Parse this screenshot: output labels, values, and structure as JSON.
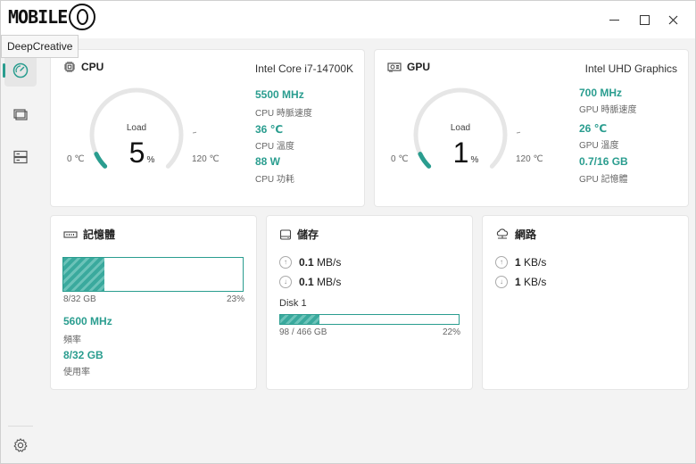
{
  "app": {
    "logo_text": "MOBILE",
    "tooltip": "DeepCreative"
  },
  "window_controls": {
    "minimize": "minimize",
    "maximize": "maximize",
    "close": "close"
  },
  "sidebar": {
    "items": [
      "dashboard-gauge-icon",
      "monitor-icon",
      "storage-icon"
    ],
    "settings": "gear-icon"
  },
  "cpu": {
    "title": "CPU",
    "model": "Intel Core i7-14700K",
    "load_label": "Load",
    "load_value": "5",
    "load_unit": "%",
    "min_label": "0 ℃",
    "max_label": "120 ℃",
    "freq_value": "5500 MHz",
    "freq_label": "CPU 時脈速度",
    "temp_value": "36 ℃",
    "temp_label": "CPU 溫度",
    "power_value": "88 W",
    "power_label": "CPU 功耗",
    "gauge_fraction": 0.05
  },
  "gpu": {
    "title": "GPU",
    "model": "Intel UHD Graphics",
    "load_label": "Load",
    "load_value": "1",
    "load_unit": "%",
    "min_label": "0 ℃",
    "max_label": "120 ℃",
    "freq_value": "700 MHz",
    "freq_label": "GPU 時脈速度",
    "temp_value": "26 ℃",
    "temp_label": "GPU 溫度",
    "mem_value": "0.7/16 GB",
    "mem_label": "GPU 記憶體",
    "gauge_fraction": 0.01
  },
  "memory": {
    "title": "記憶體",
    "usage_text": "8/32 GB",
    "usage_percent": "23%",
    "usage_fraction": 0.23,
    "freq_value": "5600 MHz",
    "freq_label": "頻率",
    "used_value": "8/32 GB",
    "used_label": "使用率"
  },
  "storage": {
    "title": "儲存",
    "read_value": "0.1",
    "read_unit": "MB/s",
    "write_value": "0.1",
    "write_unit": "MB/s",
    "disk_name": "Disk 1",
    "disk_usage": "98 / 466 GB",
    "disk_percent": "22%",
    "disk_fraction": 0.22
  },
  "network": {
    "title": "網路",
    "up_value": "1",
    "up_unit": "KB/s",
    "down_value": "1",
    "down_unit": "KB/s"
  },
  "colors": {
    "accent": "#2a9d8f",
    "track": "#e6e6e6"
  }
}
